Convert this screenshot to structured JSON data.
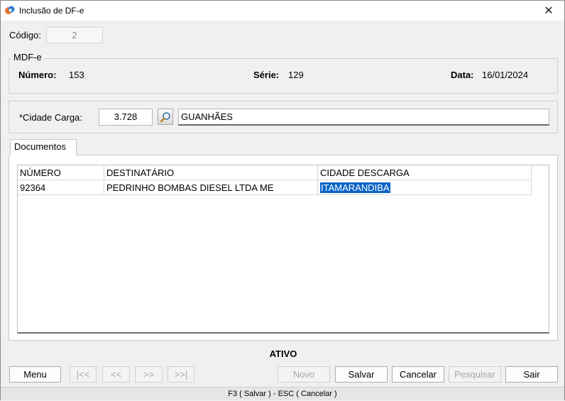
{
  "window": {
    "title": "Inclusão de DF-e",
    "close_glyph": "✕"
  },
  "codigo": {
    "label": "Código:",
    "value": "2"
  },
  "mdfe": {
    "legend": "MDF-e",
    "numero_label": "Número:",
    "numero_value": "153",
    "serie_label": "Série:",
    "serie_value": "129",
    "data_label": "Data:",
    "data_value": "16/01/2024"
  },
  "carga": {
    "label": "*Cidade Carga:",
    "code": "3.728",
    "name": "GUANHÃES",
    "search_icon": "magnifier-icon"
  },
  "tabs": {
    "documentos": "Documentos"
  },
  "grid": {
    "columns": [
      "NÚMERO",
      "DESTINATÁRIO",
      "CIDADE DESCARGA"
    ],
    "rows": [
      [
        "92364",
        "PEDRINHO BOMBAS DIESEL LTDA ME",
        "ITAMARANDIBA"
      ]
    ]
  },
  "status": "ATIVO",
  "buttons": {
    "menu": "Menu",
    "first": "|<<",
    "prev": "<<",
    "next": ">>",
    "last": ">>|",
    "novo": "Novo",
    "salvar": "Salvar",
    "cancelar": "Cancelar",
    "pesquisar": "Pesquisar",
    "sair": "Sair"
  },
  "statusbar": "F3 ( Salvar )  -  ESC ( Cancelar )",
  "colors": {
    "selection": "#0a64c8",
    "accent_orange": "#e8742a",
    "accent_blue": "#2f7fd3"
  }
}
